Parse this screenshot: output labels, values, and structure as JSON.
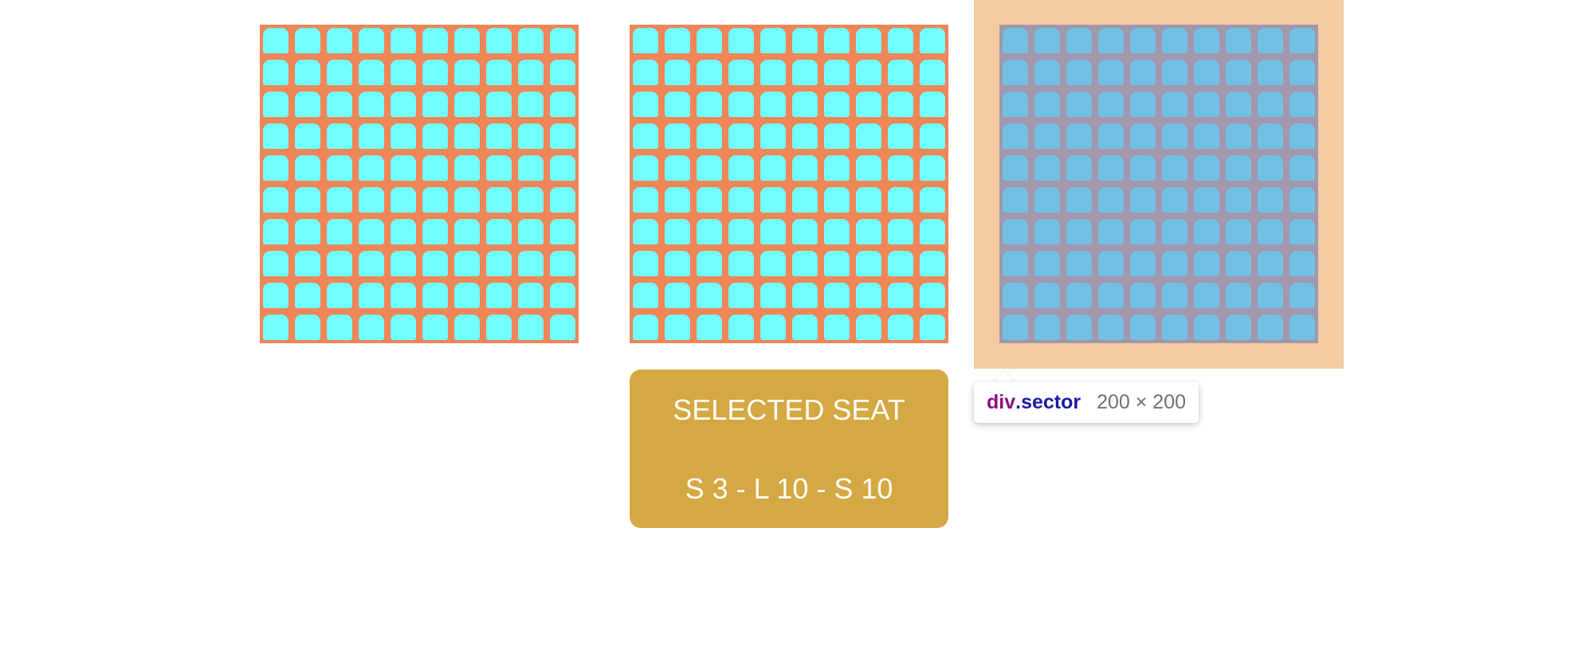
{
  "sectors": [
    {
      "id": "sector-1",
      "rows": 10,
      "cols": 10
    },
    {
      "id": "sector-2",
      "rows": 10,
      "cols": 10
    },
    {
      "id": "sector-3",
      "rows": 10,
      "cols": 10
    }
  ],
  "selected": {
    "title": "SELECTED SEAT",
    "value": "S 3 - L 10 - S 10"
  },
  "tooltip": {
    "tag": "div",
    "class_name": ".sector",
    "dimensions": "200 × 200"
  },
  "colors": {
    "sector_background": "#ee8658",
    "seat": "#72ffff",
    "selected_box": "#d4a842",
    "highlight_margin": "#f3cca2",
    "highlight_content": "#72c0e3"
  }
}
